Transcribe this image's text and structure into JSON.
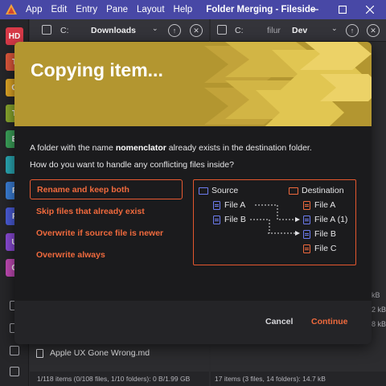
{
  "titlebar": {
    "menu": [
      "App",
      "Edit",
      "Entry",
      "Pane",
      "Layout",
      "Help"
    ],
    "title": "Folder Merging - Fileside",
    "logo_icon": "fileside-logo"
  },
  "left_rail": {
    "drives": [
      {
        "label": "HD",
        "color": "#d83a48"
      },
      {
        "label": "T",
        "color": "#e0583c"
      },
      {
        "label": "C",
        "color": "#e0a626"
      },
      {
        "label": "T",
        "color": "#8aa82e"
      },
      {
        "label": "E",
        "color": "#3ba25a"
      },
      {
        "label": "",
        "color": "#2aa8b4"
      },
      {
        "label": "F",
        "color": "#3a7ed6"
      },
      {
        "label": "F",
        "color": "#4a5cd8"
      },
      {
        "label": "U",
        "color": "#8a4ad6"
      },
      {
        "label": "C",
        "color": "#c04ab4"
      }
    ]
  },
  "left_pane": {
    "path_prefix": "C:",
    "path_folder": "Downloads",
    "visible_file": "Apple UX Gone Wrong.md",
    "status": "1/118 items (0/108 files, 1/10 folders): 0 B/1.99 GB"
  },
  "right_pane": {
    "path_prefix": "C:",
    "path_partial": "filur",
    "path_folder": "Dev",
    "sizes": [
      "kB",
      "2 kB",
      "8 kB"
    ],
    "status": "17 items (3 files, 14 folders): 14.7 kB"
  },
  "dialog": {
    "title": "Copying item...",
    "message_pre": "A folder with the name ",
    "message_name": "nomenclator",
    "message_post": " already exists in the destination folder.",
    "question": "How do you want to handle any conflicting files inside?",
    "options": [
      "Rename and keep both",
      "Skip files that already exist",
      "Overwrite if source file is newer",
      "Overwrite always"
    ],
    "selected_option": 0,
    "diagram": {
      "source_label": "Source",
      "destination_label": "Destination",
      "source_files": [
        "File A",
        "File B"
      ],
      "destination_files": [
        "File A",
        "File A (1)",
        "File B",
        "File C"
      ]
    },
    "cancel_label": "Cancel",
    "continue_label": "Continue"
  },
  "colors": {
    "titlebar": "#4848a6",
    "header_gold": "#b39630",
    "accent_orange": "#f06a3d",
    "highlight_blue": "#6d7cf0",
    "dialog_bg": "#1b1b1d"
  }
}
